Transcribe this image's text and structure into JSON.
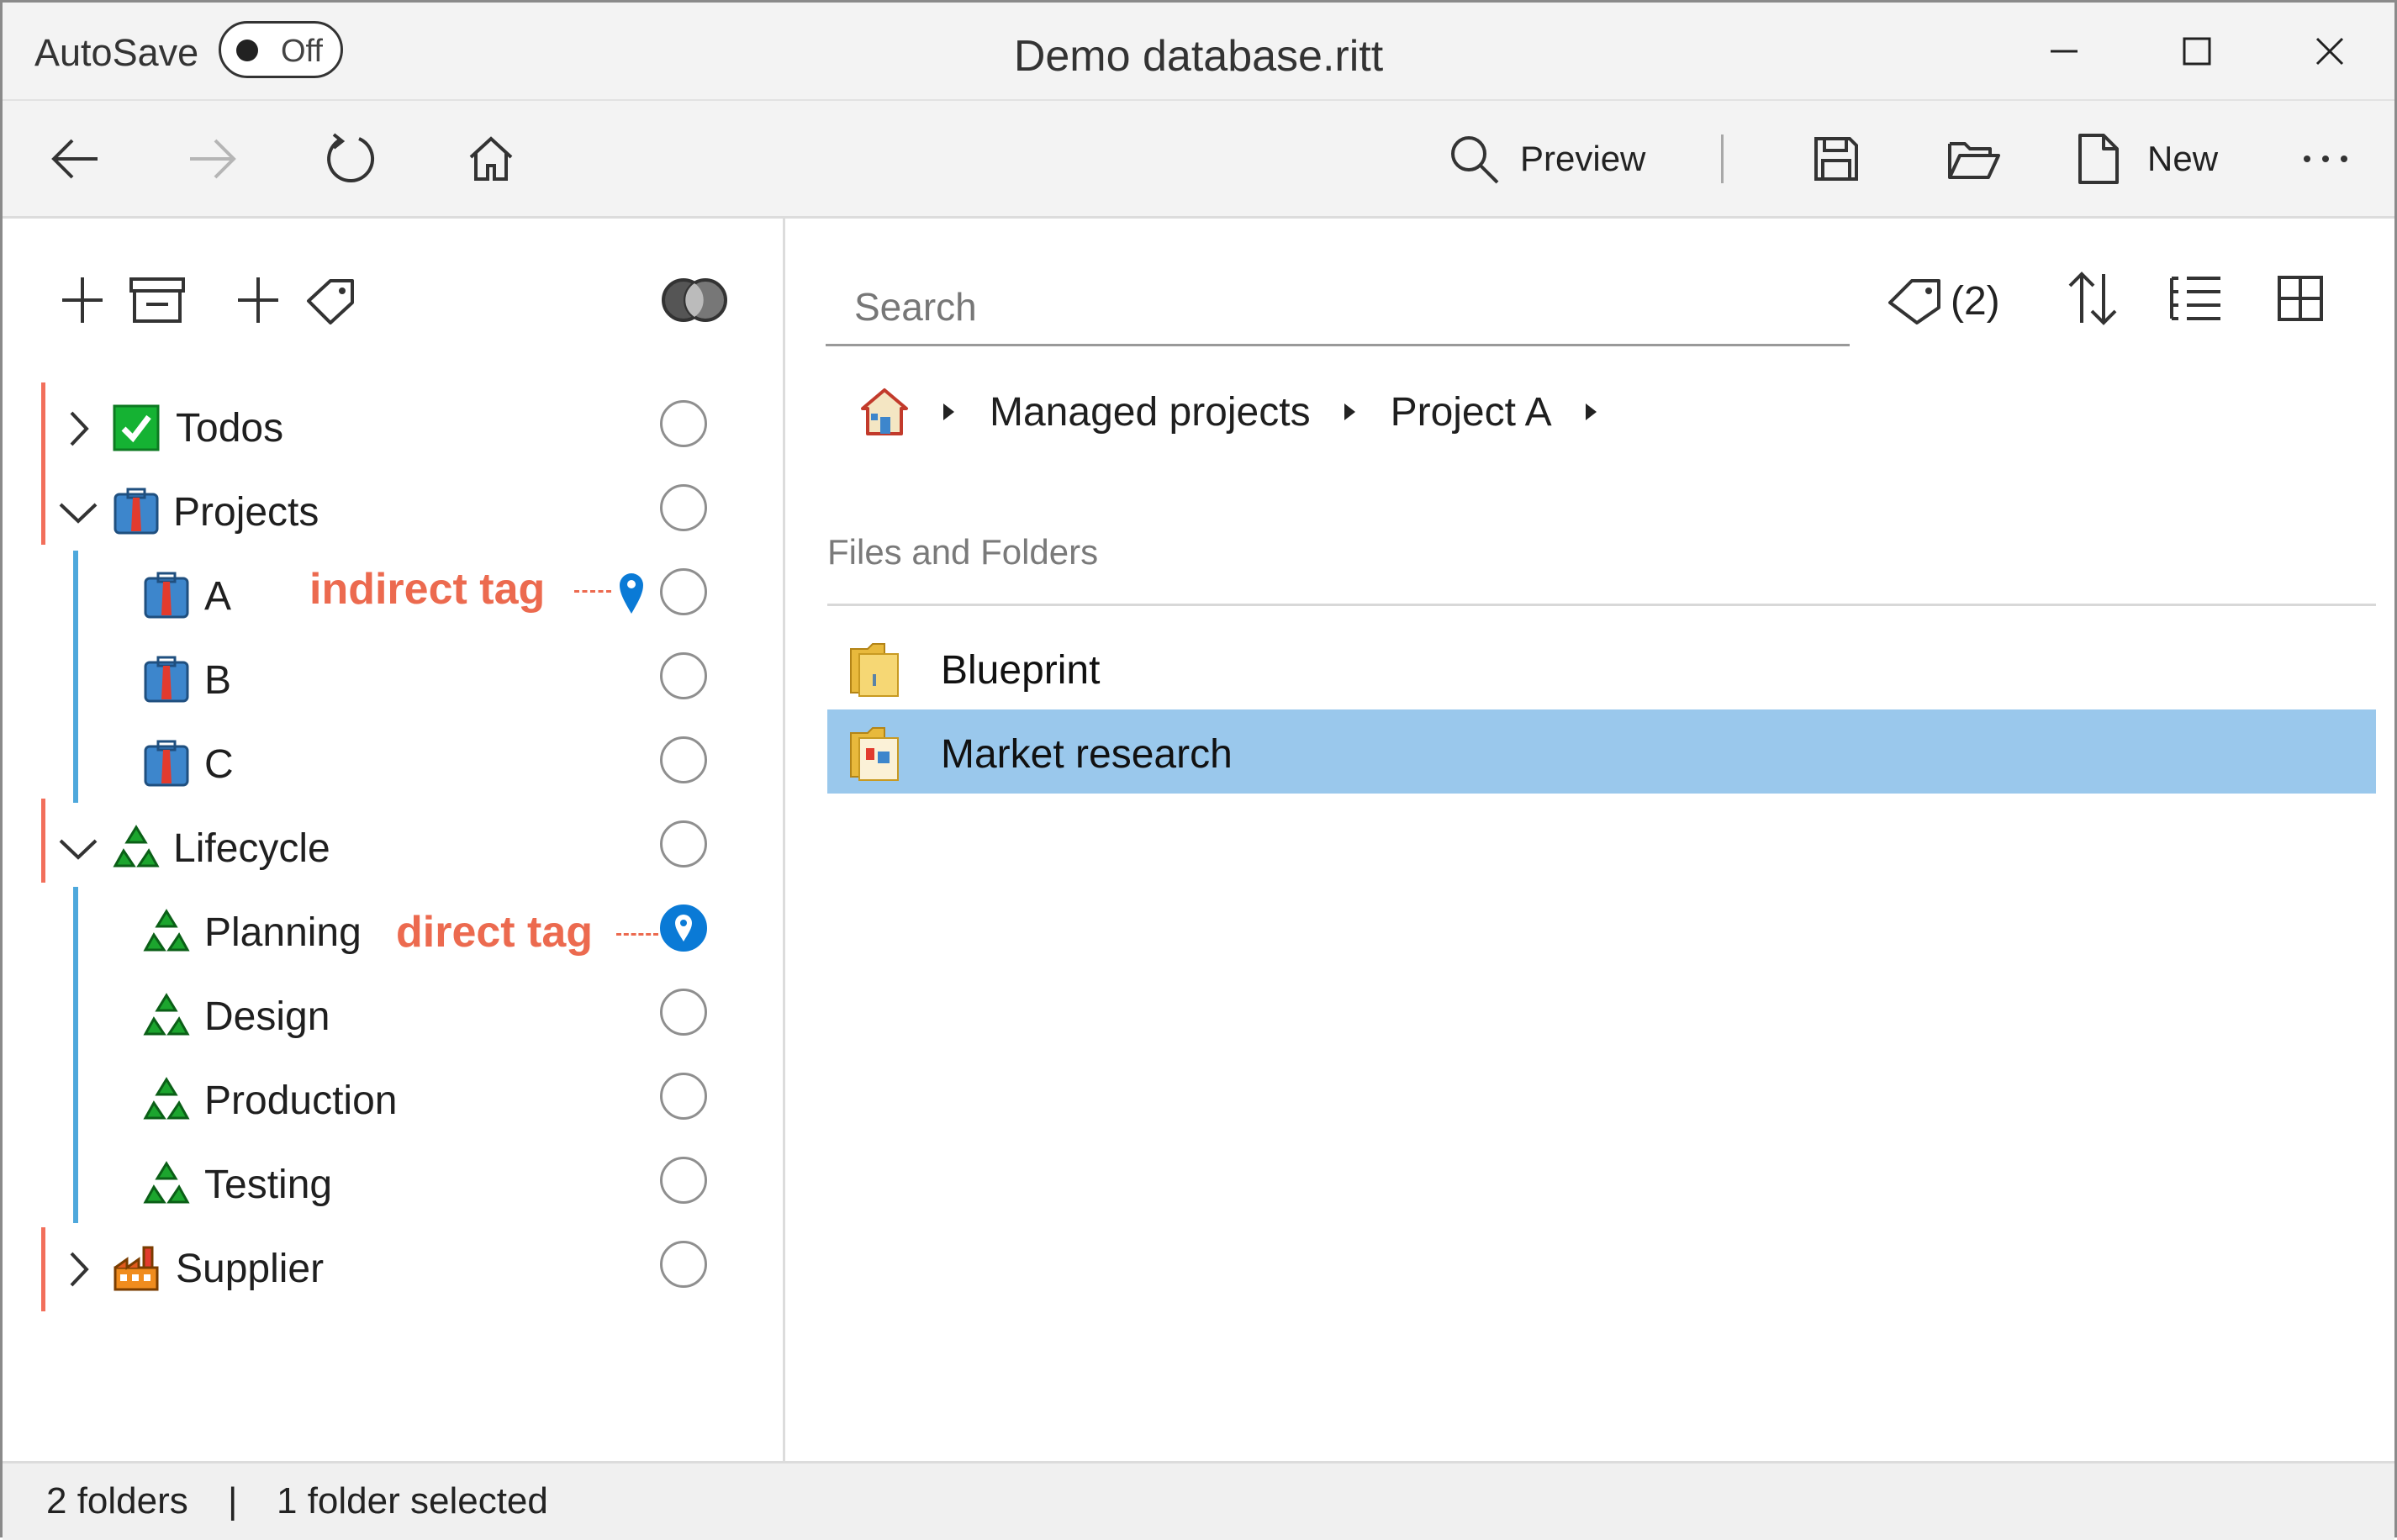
{
  "window": {
    "title": "Demo database.ritt",
    "autosave_label": "AutoSave",
    "autosave_state": "Off"
  },
  "toolbar": {
    "preview_label": "Preview",
    "new_label": "New"
  },
  "left_toolbar": {
    "icons": [
      "add-folder-icon",
      "add-tag-icon",
      "tag-filter-mode-icon"
    ]
  },
  "tree": {
    "items": [
      {
        "label": "Todos",
        "icon": "checkbox-icon"
      },
      {
        "label": "Projects",
        "icon": "briefcase-icon"
      },
      {
        "label": "A",
        "icon": "briefcase-icon"
      },
      {
        "label": "B",
        "icon": "briefcase-icon"
      },
      {
        "label": "C",
        "icon": "briefcase-icon"
      },
      {
        "label": "Lifecycle",
        "icon": "recycle-icon"
      },
      {
        "label": "Planning",
        "icon": "recycle-icon"
      },
      {
        "label": "Design",
        "icon": "recycle-icon"
      },
      {
        "label": "Production",
        "icon": "recycle-icon"
      },
      {
        "label": "Testing",
        "icon": "recycle-icon"
      },
      {
        "label": "Supplier",
        "icon": "factory-icon"
      }
    ]
  },
  "annotations": {
    "indirect": "indirect tag",
    "direct": "direct tag"
  },
  "search": {
    "placeholder": "Search"
  },
  "right_toolbar": {
    "tag_count": "(2)"
  },
  "breadcrumb": [
    "Managed projects",
    "Project A"
  ],
  "files": {
    "section_title": "Files and Folders",
    "items": [
      {
        "label": "Blueprint"
      },
      {
        "label": "Market research",
        "selected": true
      }
    ]
  },
  "status": {
    "folders": "2 folders",
    "separator": "|",
    "selected": "1 folder selected"
  },
  "colors": {
    "accent_blue": "#0a7ad6",
    "selection": "#9ac8ec",
    "annotation": "#ec6a4f",
    "tree_red_bar": "#f26f5b",
    "tree_blue_bar": "#4ea8dc"
  }
}
